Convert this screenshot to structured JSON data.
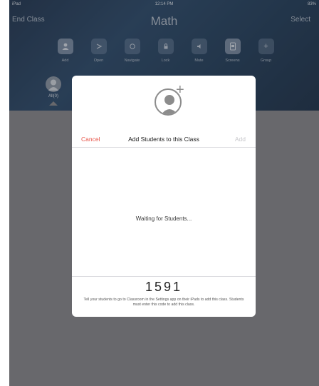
{
  "status": {
    "device": "iPad",
    "time": "12:14 PM",
    "battery": "83%"
  },
  "nav": {
    "left": "End Class",
    "title": "Math",
    "right": "Select"
  },
  "toolbar": [
    {
      "label": "Add",
      "icon": "add-person-icon"
    },
    {
      "label": "Open",
      "icon": "open-icon"
    },
    {
      "label": "Navigate",
      "icon": "navigate-icon"
    },
    {
      "label": "Lock",
      "icon": "lock-icon"
    },
    {
      "label": "Mute",
      "icon": "mute-icon"
    },
    {
      "label": "Screens",
      "icon": "screens-icon"
    },
    {
      "label": "Group",
      "icon": "plus-icon"
    }
  ],
  "group": {
    "label": "All(0)"
  },
  "sheet": {
    "cancel": "Cancel",
    "title": "Add Students to this Class",
    "add": "Add",
    "waiting": "Waiting for Students...",
    "code": "1591",
    "instructions": "Tell your students to go to Classroom in the Settings app on their iPads to add this class. Students must enter this code to add this class."
  }
}
